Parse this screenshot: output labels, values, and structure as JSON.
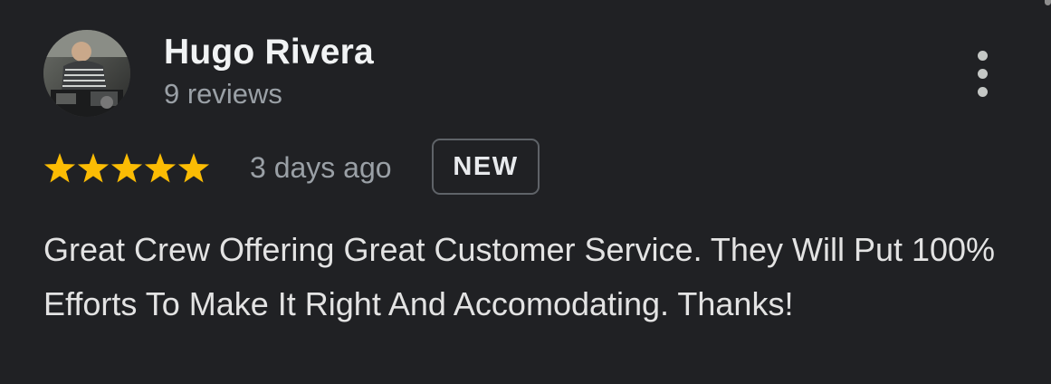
{
  "review": {
    "reviewer_name": "Hugo Rivera",
    "review_count": "9 reviews",
    "avatar_icon": "reviewer-photo",
    "more_options_icon": "more-vert-icon",
    "rating": 5,
    "rating_max": 5,
    "star_color": "#fbbc04",
    "date": "3 days ago",
    "badge": "NEW",
    "text": "Great Crew Offering Great Customer Service. They Will Put 100% Efforts To Make It Right And Accomodating. Thanks!"
  },
  "colors": {
    "background": "#202124",
    "name": "#f1f3f4",
    "secondary": "#9aa0a6",
    "badge_border": "#5f6368"
  }
}
